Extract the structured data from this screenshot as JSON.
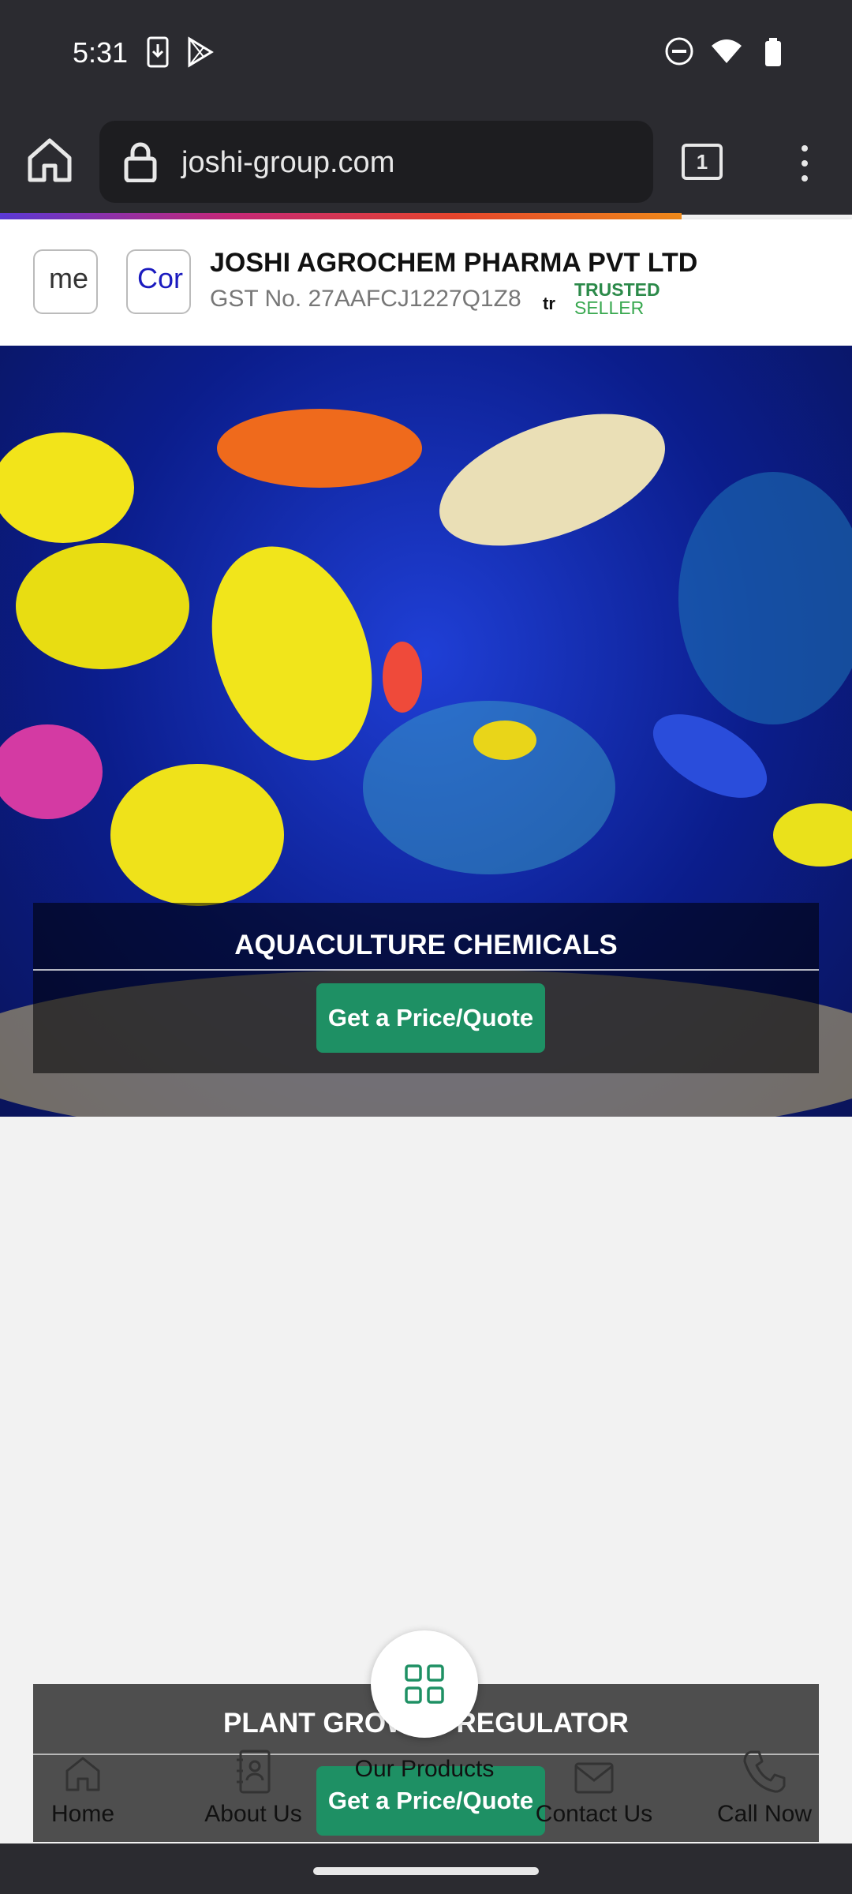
{
  "status_bar": {
    "time": "5:31",
    "left_icons": [
      "download-icon",
      "play-store-icon"
    ],
    "right_icons": [
      "do-not-disturb-icon",
      "wifi-icon",
      "battery-icon"
    ]
  },
  "browser": {
    "url": "joshi-group.com",
    "tab_count": "1",
    "load_progress": 0.8
  },
  "header": {
    "logo_text_1": "me",
    "logo_text_2": "Cor",
    "company_name": "JOSHI AGROCHEM PHARMA PVT LTD",
    "gst": "GST No. 27AAFCJ1227Q1Z8",
    "tr_mark": "tr",
    "trusted_line1": "TRUSTED",
    "trusted_line2": "SELLER"
  },
  "banner": {
    "title": "AQUACULTURE CHEMICALS",
    "button_label": "Get a Price/Quote"
  },
  "lower_banner": {
    "title": "PLANT GROWTH REGULATOR",
    "button_label": "Get a Price/Quote"
  },
  "bottom_nav": {
    "items": [
      {
        "label": "Home",
        "icon": "home-icon"
      },
      {
        "label": "About Us",
        "icon": "contacts-book-icon"
      },
      {
        "label": "Our Products",
        "icon": "grid-icon"
      },
      {
        "label": "Contact Us",
        "icon": "mail-icon"
      },
      {
        "label": "Call Now",
        "icon": "phone-icon"
      }
    ]
  },
  "colors": {
    "accent_green": "#1e9064",
    "status_bar": "#2b2b30",
    "trusted_green": "#2c8a4a"
  }
}
